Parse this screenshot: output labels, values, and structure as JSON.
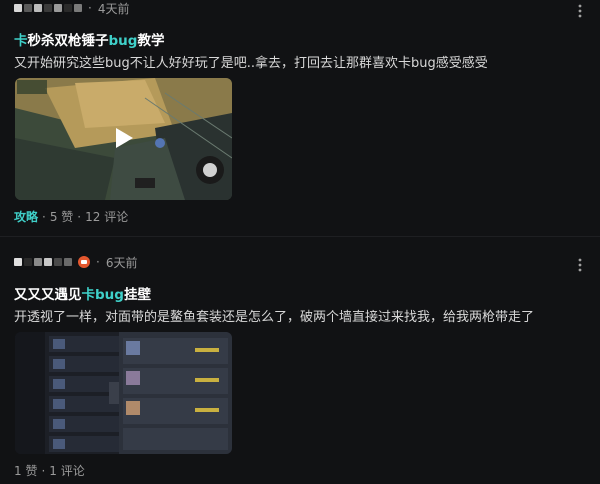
{
  "posts": [
    {
      "time": "4天前",
      "more_icon": "more-vertical-icon",
      "title_parts": [
        "卡",
        "秒杀双枪锤子",
        "bug",
        "教学"
      ],
      "body": "又开始研究这些bug不让人好好玩了是吧..拿去，打回去让那群喜欢卡bug感受感受",
      "media_type": "video",
      "tag": "攻略",
      "likes": "5 赞",
      "comments": "12 评论",
      "separator": "·"
    },
    {
      "time": "6天前",
      "more_icon": "more-vertical-icon",
      "title_parts": [
        "又又又遇见",
        "卡bug",
        "挂壁"
      ],
      "body": "开透视了一样，对面带的是鳌鱼套装还是怎么了，破两个墙直接过来找我，给我两枪带走了",
      "media_type": "image",
      "likes": "1 赞",
      "comments": "1 评论",
      "separator": "·"
    }
  ],
  "colors": {
    "background": "#111214",
    "accent": "#3fd0c9",
    "text_primary": "#ffffff",
    "text_secondary": "#9a9a9a"
  }
}
